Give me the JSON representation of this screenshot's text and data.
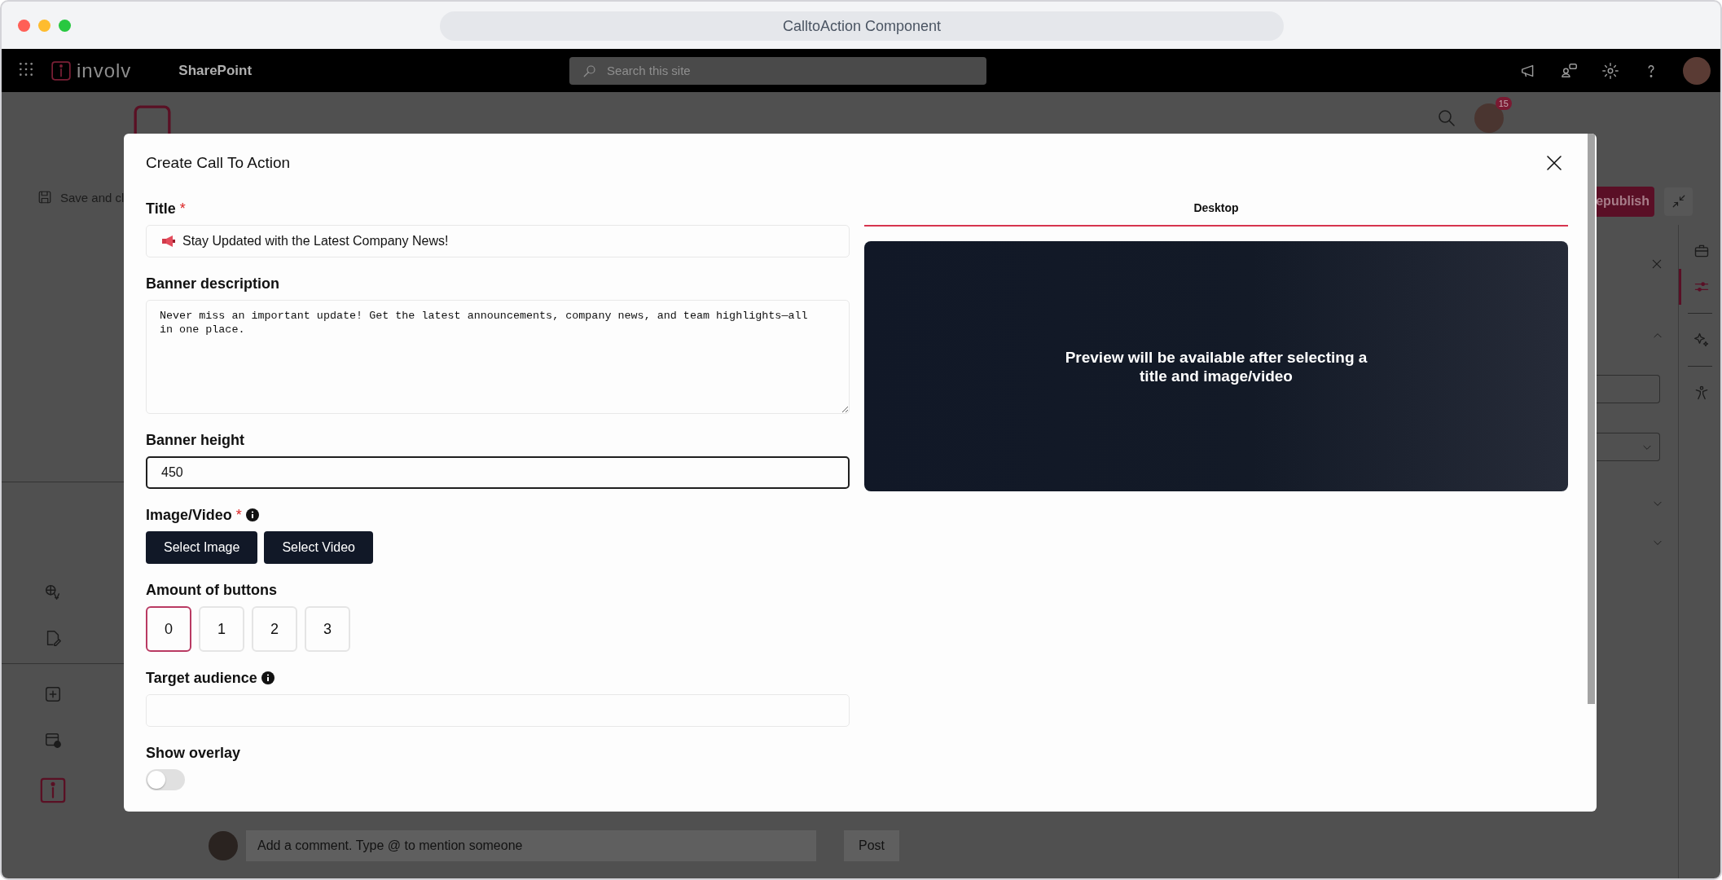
{
  "browser": {
    "title": "CalltoAction Component"
  },
  "suite_bar": {
    "brand": "involv",
    "app": "SharePoint",
    "search": {
      "placeholder": "Search this site"
    }
  },
  "page": {
    "save_button": "Save and cl",
    "republish_button": "epublish",
    "notification_count": "15",
    "comment": {
      "placeholder": "Add a comment. Type @ to mention someone",
      "post_button": "Post"
    },
    "side_panel": {
      "tabs": [
        {
          "kind": "briefcase",
          "selected": false
        },
        {
          "kind": "sliders",
          "selected": true
        },
        {
          "kind": "sparkle",
          "selected": false
        },
        {
          "kind": "person",
          "selected": false
        }
      ]
    }
  },
  "dialog": {
    "title": "Create Call To Action",
    "fields": [
      {
        "kind": "input",
        "label": "Title",
        "required_mark": "*",
        "has_icon": true,
        "value": "Stay Updated with the Latest Company News!",
        "focused": false
      },
      {
        "kind": "textarea",
        "label": "Banner description",
        "value": "Never miss an important update! Get the latest announcements, company news, and team highlights—all in one place."
      },
      {
        "kind": "input",
        "label": "Banner height",
        "value": "450",
        "focused": true
      },
      {
        "kind": "media",
        "label": "Image/Video",
        "required_mark": "*",
        "info": true,
        "buttons": [
          "Select Image",
          "Select Video"
        ]
      },
      {
        "kind": "choice",
        "label": "Amount of buttons",
        "options": [
          {
            "label": "0",
            "selected": true
          },
          {
            "label": "1",
            "selected": false
          },
          {
            "label": "2",
            "selected": false
          },
          {
            "label": "3",
            "selected": false
          }
        ]
      },
      {
        "kind": "input",
        "label": "Target audience",
        "info": true,
        "focused": false
      },
      {
        "kind": "toggle",
        "label": "Show overlay",
        "on": false
      }
    ],
    "preview": {
      "tab": "Desktop",
      "message": "Preview will be available after selecting a title and image/video"
    }
  }
}
